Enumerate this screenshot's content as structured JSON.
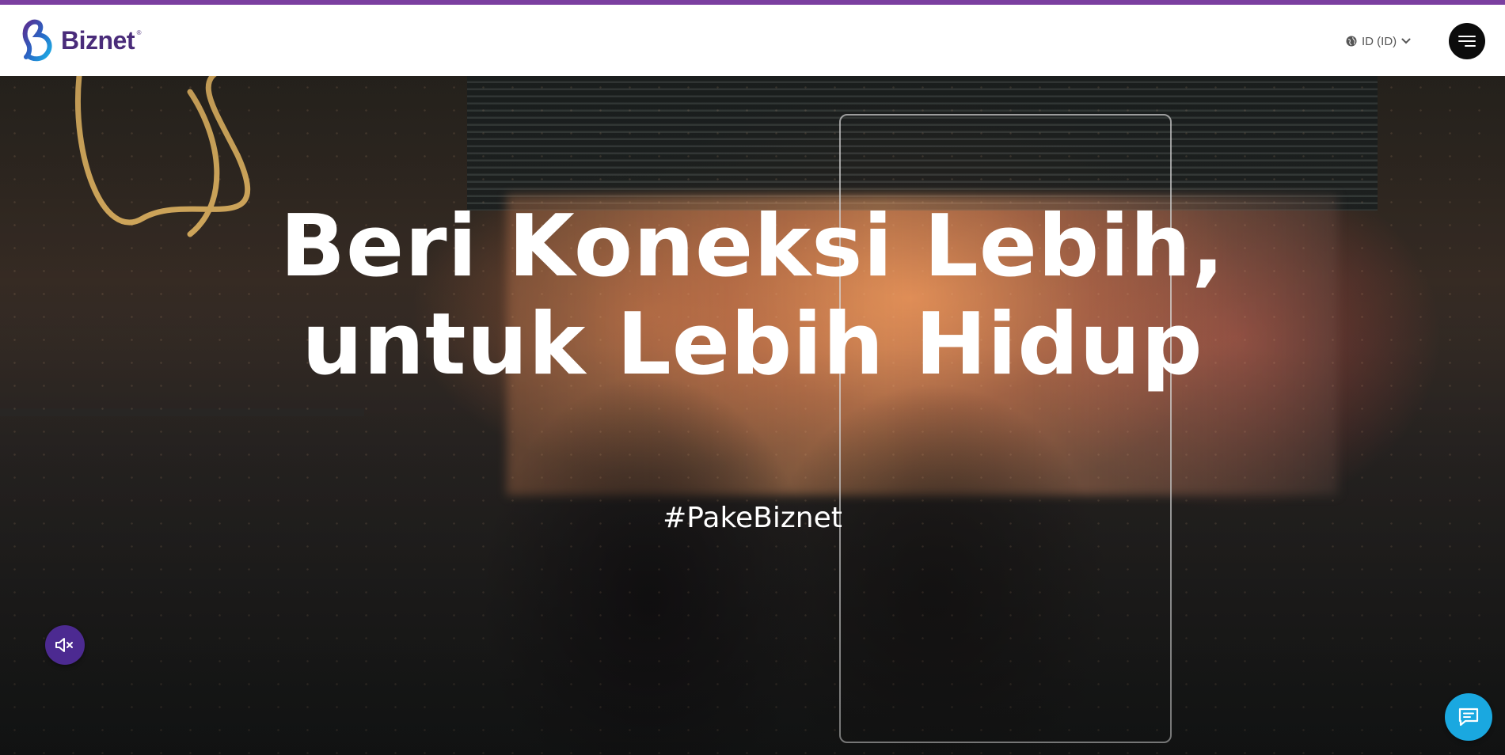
{
  "brand": {
    "name": "Biznet",
    "registered_mark": "®",
    "accent_color": "#7b3fa0",
    "text_color": "#4a2c7a",
    "logo_icon": "biznet-b-logo-icon"
  },
  "header": {
    "language": {
      "label": "ID (ID)",
      "icon": "globe-icon",
      "dropdown_icon": "chevron-down-icon"
    },
    "menu_icon": "hamburger-menu-icon"
  },
  "hero": {
    "title_line1": "Beri Koneksi Lebih,",
    "title_line2": "untuk Lebih Hidup",
    "tagline": "#PakeBiznet"
  },
  "controls": {
    "mute_icon": "speaker-muted-icon",
    "mute_color": "#4c2a91",
    "chat_icon": "chat-bubble-icon",
    "chat_color": "#1aa8e0"
  }
}
